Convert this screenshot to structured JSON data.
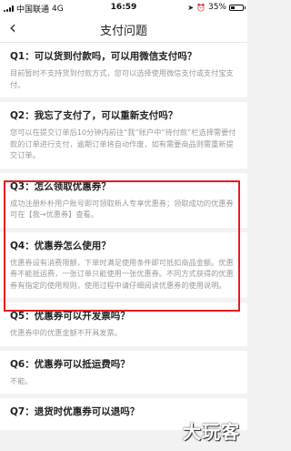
{
  "status_bar": {
    "carrier": "中国联通",
    "network": "4G",
    "time": "16:59",
    "battery": "35%",
    "battery_level": 0.35
  },
  "nav": {
    "back_icon": "chevron-left-icon",
    "title": "支付问题"
  },
  "faqs": [
    {
      "q": "Q1：可以货到付款吗，可以用微信支付吗？",
      "a": "目前暂时不支持货到付款方式，您可以选择使用微信支付或支付宝支付。"
    },
    {
      "q": "Q2：我忘了支付了，可以重新支付吗？",
      "a": "您可以在提交订单后10分钟内前往“我”账户中“待付款”栏选择需要付款的订单进行支付，逾期订单将自动作废，如有需要商品则需重新提交订单。"
    },
    {
      "q": "Q3：怎么领取优惠券？",
      "a": "成功注册朴朴用户账号即可领取新人专享优惠券；领取成功的优惠券可在【我→优惠券】查看。"
    },
    {
      "q": "Q4：优惠券怎么使用？",
      "a": "优惠券设有消费限额，下单时满足使用条件即可抵扣商品金额。优惠券不能抵运费，一张订单只能使用一张优惠券。不同方式获得的优惠券有指定的使用规则，使用过程中请仔细阅读优惠券的使用说明。"
    },
    {
      "q": "Q5：优惠券可以开发票吗？",
      "a": "优惠券中的优惠金额不开具发票。"
    },
    {
      "q": "Q6：优惠券可以抵运费吗？",
      "a": "不能。"
    },
    {
      "q": "Q7：退货时优惠券可以退吗？",
      "a": ""
    }
  ],
  "watermark": "大玩客"
}
